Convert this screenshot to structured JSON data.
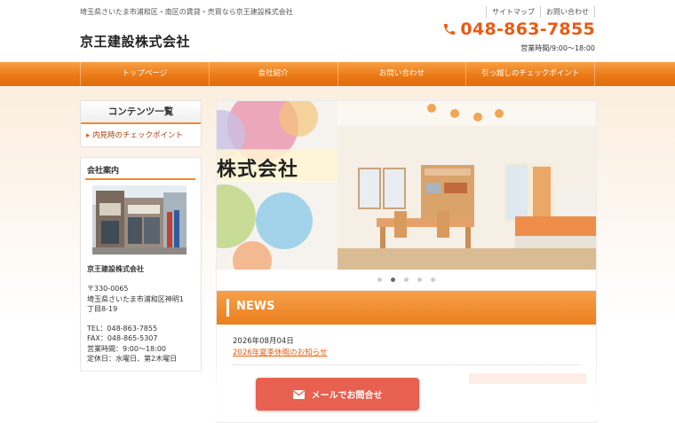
{
  "header": {
    "tagline": "埼玉県さいたま市浦和区・南区の賃貸・売買なら京王建設株式会社",
    "site_title": "京王建設株式会社",
    "links": [
      "サイトマップ",
      "お問い合わせ"
    ],
    "phone": "048-863-7855",
    "hours": "営業時間/9:00〜18:00"
  },
  "nav": {
    "items": [
      "トップページ",
      "会社紹介",
      "お問い合わせ",
      "引っ越しのチェックポイント"
    ]
  },
  "sidebar": {
    "contents_heading": "コンテンツ一覧",
    "contents_link": "内見時のチェックポイント",
    "company_heading": "会社案内",
    "company_name": "京王建設株式会社",
    "postal": "〒330-0065",
    "address_line1": "埼玉県さいたま市浦和区神明1",
    "address_line2": "丁目8-19",
    "tel": "TEL：048-863-7855",
    "fax": "FAX：048-865-5307",
    "hours": "営業時間：9:00〜18:00",
    "holiday": "定休日：水曜日、第2木曜日"
  },
  "slider": {
    "caption": "株式会社",
    "dot_count": 5,
    "active_dot": 1
  },
  "news": {
    "heading": "NEWS",
    "date": "2026年08月04日",
    "link": "2026年夏季休暇のお知らせ"
  },
  "cta": {
    "label": "メールでお問合せ"
  },
  "colors": {
    "accent": "#ec7a17",
    "phone": "#ea5a14",
    "cta": "#e8604f"
  }
}
